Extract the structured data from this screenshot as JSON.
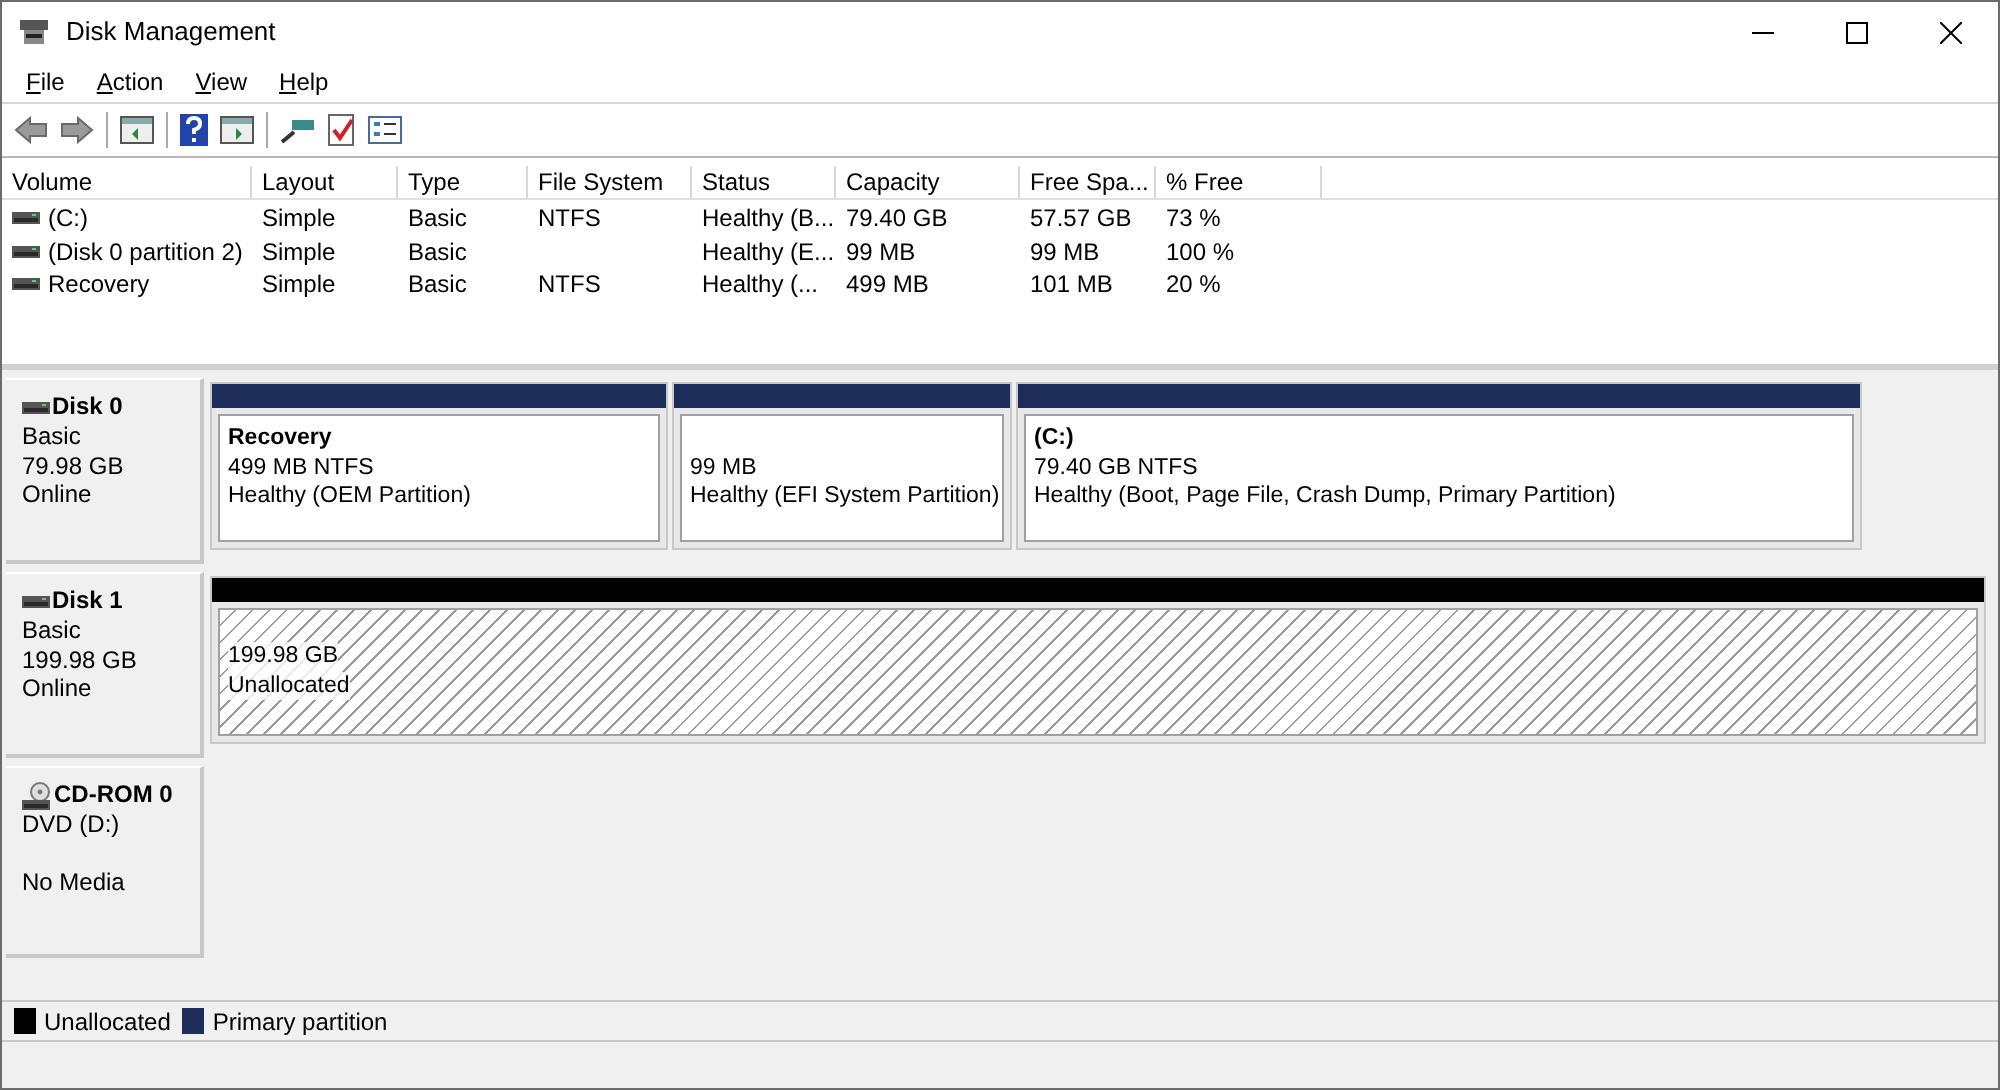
{
  "window": {
    "title": "Disk Management"
  },
  "menu": [
    "File",
    "Action",
    "View",
    "Help"
  ],
  "table": {
    "columns": [
      "Volume",
      "Layout",
      "Type",
      "File System",
      "Status",
      "Capacity",
      "Free Spa...",
      "% Free"
    ],
    "rows": [
      {
        "cells": [
          "(C:)",
          "Simple",
          "Basic",
          "NTFS",
          "Healthy (B...",
          "79.40 GB",
          "57.57 GB",
          "73 %"
        ]
      },
      {
        "cells": [
          "(Disk 0 partition 2)",
          "Simple",
          "Basic",
          "",
          "Healthy (E...",
          "99 MB",
          "99 MB",
          "100 %"
        ]
      },
      {
        "cells": [
          "Recovery",
          "Simple",
          "Basic",
          "NTFS",
          "Healthy (...",
          "499 MB",
          "101 MB",
          "20 %"
        ]
      }
    ]
  },
  "disks": [
    {
      "kind": "disk",
      "name": "Disk 0",
      "lines": [
        "Basic",
        "79.98 GB",
        "Online"
      ],
      "partitions": [
        {
          "kind": "primary",
          "title": "Recovery",
          "size": "499 MB NTFS",
          "status": "Healthy (OEM Partition)"
        },
        {
          "kind": "primary",
          "size": "99 MB",
          "status": "Healthy (EFI System Partition)"
        },
        {
          "kind": "primary",
          "title": "(C:)",
          "size": "79.40 GB NTFS",
          "status": "Healthy (Boot, Page File, Crash Dump, Primary Partition)"
        }
      ]
    },
    {
      "kind": "disk",
      "name": "Disk 1",
      "lines": [
        "Basic",
        "199.98 GB",
        "Online"
      ],
      "partitions": [
        {
          "kind": "unallocated",
          "size": "199.98 GB",
          "status": "Unallocated"
        }
      ]
    },
    {
      "kind": "cdrom",
      "name": "CD-ROM 0",
      "lines": [
        "DVD (D:)",
        "No Media"
      ]
    }
  ],
  "legend": [
    {
      "label": "Unallocated",
      "color": "#000000"
    },
    {
      "label": "Primary partition",
      "color": "#1f2d5a"
    }
  ]
}
